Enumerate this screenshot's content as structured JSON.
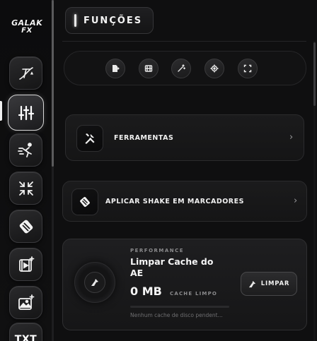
{
  "header": {
    "title": "FUNÇÕES"
  },
  "logo": {
    "line1": "GALAK",
    "line2": "FX"
  },
  "sidebar": {
    "items": [
      {
        "icon": "text-path-icon"
      },
      {
        "icon": "sliders-icon",
        "active": true
      },
      {
        "icon": "motion-runner-icon"
      },
      {
        "icon": "compress-arrows-icon"
      },
      {
        "icon": "shake-stack-icon"
      },
      {
        "icon": "video-sparkle-icon"
      },
      {
        "icon": "image-sparkle-icon"
      },
      {
        "icon": "txt-icon",
        "label": "TXT"
      }
    ]
  },
  "toolbar": {
    "buttons": [
      "import-icon",
      "film-icon",
      "magic-wand-icon",
      "target-icon",
      "fullscreen-icon"
    ]
  },
  "cards": {
    "tools": {
      "label": "FERRAMENTAS",
      "icon": "tools-icon"
    },
    "shake": {
      "label": "APLICAR SHAKE EM MARCADORES",
      "icon": "shake-stack-icon"
    }
  },
  "performance": {
    "eyebrow": "PERFORMANCE",
    "title": "Limpar Cache do AE",
    "size": "0 MB",
    "status": "CACHE LIMPO",
    "note": "Nenhum cache de disco pendent...",
    "button_label": "LIMPAR"
  }
}
